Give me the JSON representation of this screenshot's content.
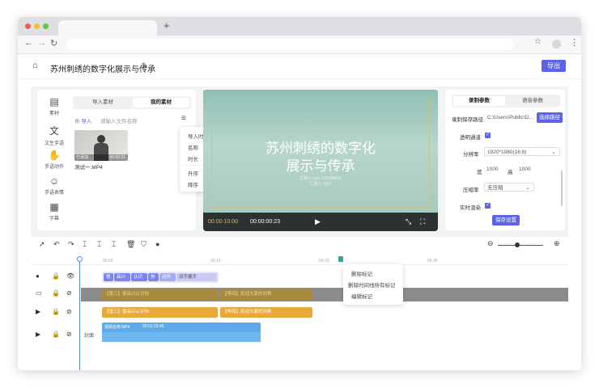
{
  "browser": {
    "new_tab_symbol": "+"
  },
  "header": {
    "title": "苏州刺绣的数字化展示与传承",
    "export_label": "导出"
  },
  "sidebar": {
    "items": [
      {
        "label": "素材",
        "icon": "file-icon"
      },
      {
        "label": "文生手语",
        "icon": "text-translate-icon"
      },
      {
        "label": "手语动作",
        "icon": "hand-icon"
      },
      {
        "label": "手语表情",
        "icon": "smile-icon"
      },
      {
        "label": "字幕",
        "icon": "subtitle-icon"
      }
    ]
  },
  "media": {
    "tabs": [
      "导入素材",
      "我的素材"
    ],
    "active_tab": "我的素材",
    "import_label": "导入",
    "search_placeholder": "请输入文件名称",
    "file": {
      "name": "测试一.MP4",
      "badge": "已添加",
      "duration": "00:02:21"
    },
    "sort_menu": [
      "导入时间",
      "名称",
      "时长",
      "升序",
      "降序"
    ]
  },
  "preview": {
    "slide_title_line1": "苏州刺绣的数字化",
    "slide_title_line2": "展示与传承",
    "slide_subtitle": "汇报人: xxx   2023/08/10",
    "slide_footer": "汇报人: 设计",
    "current_time": "00:00:10:00",
    "total_time": "00:00:00:23"
  },
  "params": {
    "tabs": [
      "录制参数",
      "语音参数"
    ],
    "active_tab": "录制参数",
    "save_path_label": "录制保存路径",
    "save_path_value": "C:\\Users\\Public\\D...",
    "choose_path_label": "选择路径",
    "transparent_label": "透明通道",
    "resolution_label": "分辨率",
    "resolution_value": "1920*1080(16:9)",
    "width_label": "宽",
    "width_value": "1000",
    "height_label": "高",
    "height_value": "1000",
    "compression_label": "压缩率",
    "compression_value": "无压缩",
    "realtime_label": "实时渲染",
    "save_label": "保存设置"
  },
  "timeline": {
    "ticks": [
      "00:00",
      "00:10",
      "00:20",
      "00:30"
    ],
    "marker_menu": [
      "删除标记",
      "删除时间线所有标记",
      "编辑标记"
    ],
    "gesture_words": [
      "很",
      "高兴",
      "认识",
      "你",
      "动作",
      "双手握手"
    ],
    "track2_clips": [
      "【第三】很高兴认识你",
      "【李四】欢迎大家的到来"
    ],
    "track3_clips": [
      "【张三】很高兴认识你",
      "【李四】欢迎大家的到来"
    ],
    "cover_label": "封面",
    "video_clip": {
      "name": "视频名称.MP4",
      "duration": "00:01:23:45"
    }
  },
  "colors": {
    "accent": "#5b63e8",
    "clip_orange": "#e8a93a",
    "clip_blue": "#5da9e9",
    "gesture_blue": "#7d83ec"
  }
}
